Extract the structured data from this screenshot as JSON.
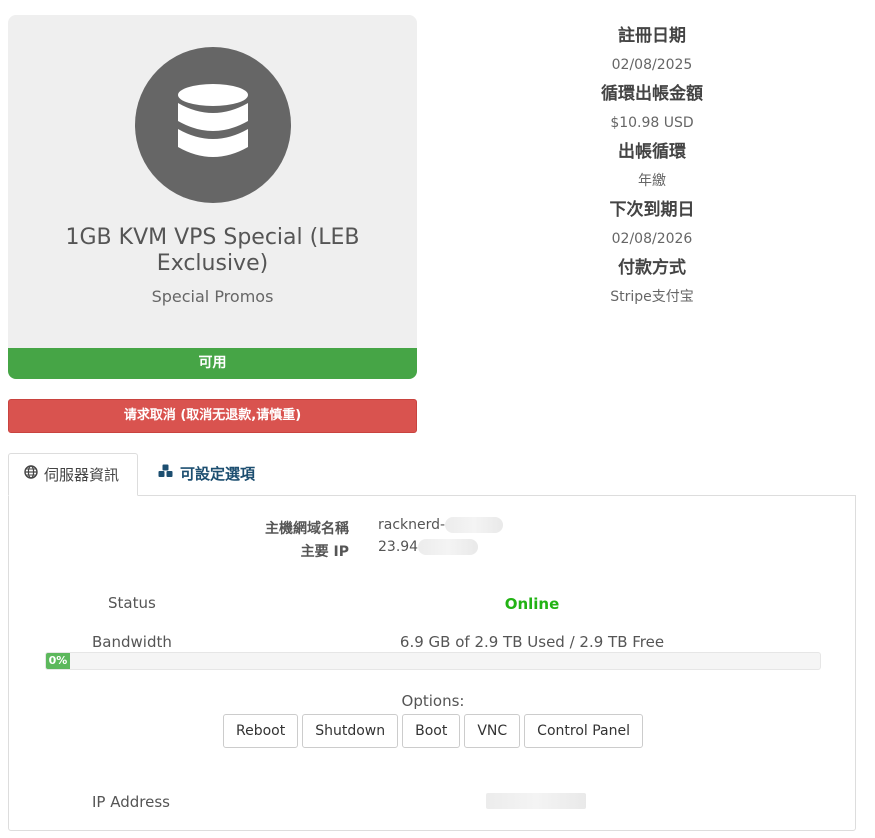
{
  "product": {
    "name": "1GB KVM VPS Special (LEB Exclusive)",
    "group": "Special Promos",
    "icon": "database-icon",
    "status": "可用"
  },
  "cancel_label": "请求取消 (取消无退款,请慎重)",
  "info": {
    "registration_label": "註冊日期",
    "registration_value": "02/08/2025",
    "recurring_label": "循環出帳金額",
    "recurring_value": "$10.98 USD",
    "cycle_label": "出帳循環",
    "cycle_value": "年繳",
    "next_due_label": "下次到期日",
    "next_due_value": "02/08/2026",
    "payment_label": "付款方式",
    "payment_value": "Stripe支付宝"
  },
  "tabs": [
    {
      "label": "伺服器資訊",
      "icon": "globe-icon",
      "active": true
    },
    {
      "label": "可設定選項",
      "icon": "cubes-icon",
      "active": false
    }
  ],
  "server": {
    "hostname_label": "主機網域名稱",
    "hostname_value": "racknerd-",
    "ip_label": "主要 IP",
    "ip_value": "23.94",
    "status_label": "Status",
    "status_value": "Online",
    "bandwidth_label": "Bandwidth",
    "bandwidth_value": "6.9 GB of 2.9 TB Used / 2.9 TB Free",
    "bandwidth_percent": "0%",
    "options_label": "Options:",
    "buttons": [
      "Reboot",
      "Shutdown",
      "Boot",
      "VNC",
      "Control Panel"
    ],
    "ip_address_label": "IP Address"
  },
  "colors": {
    "status_green": "#46a546",
    "cancel_red": "#d9534f",
    "online_green": "#22b314",
    "tab_link": "#1c4e70"
  }
}
